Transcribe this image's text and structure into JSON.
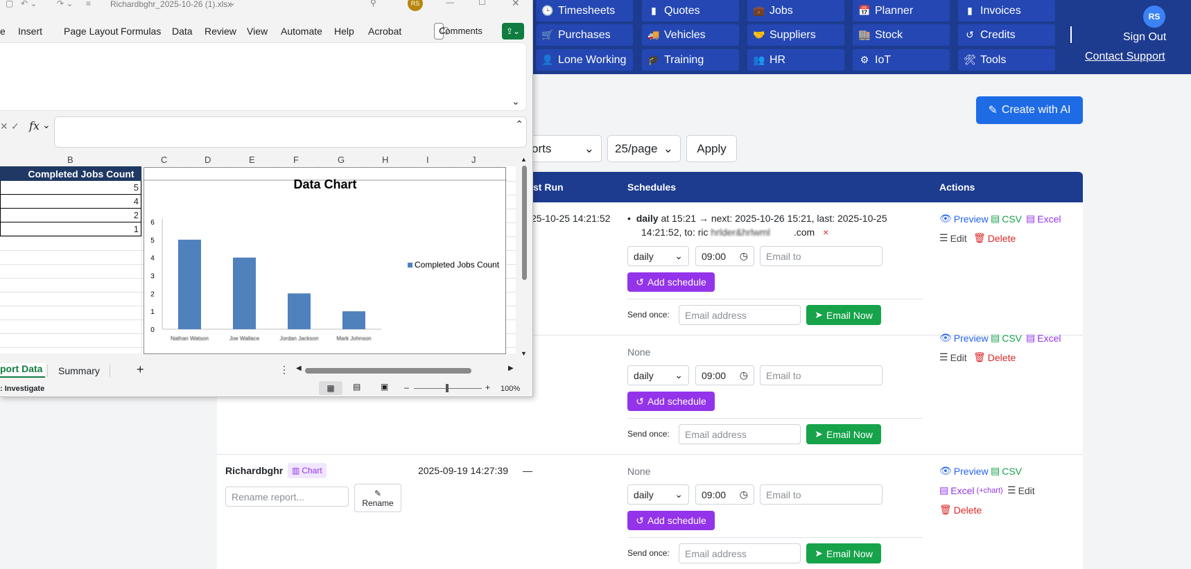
{
  "nav": {
    "items": [
      {
        "icon": "🕒",
        "label": "Timesheets"
      },
      {
        "icon": "▮",
        "label": "Quotes"
      },
      {
        "icon": "💼",
        "label": "Jobs"
      },
      {
        "icon": "📅",
        "label": "Planner"
      },
      {
        "icon": "▮",
        "label": "Invoices"
      },
      {
        "icon": "🛒",
        "label": "Purchases"
      },
      {
        "icon": "🚚",
        "label": "Vehicles"
      },
      {
        "icon": "🤝",
        "label": "Suppliers"
      },
      {
        "icon": "🏬",
        "label": "Stock"
      },
      {
        "icon": "↺",
        "label": "Credits"
      },
      {
        "icon": "👤",
        "label": "Lone Working"
      },
      {
        "icon": "🎓",
        "label": "Training"
      },
      {
        "icon": "👥",
        "label": "HR"
      },
      {
        "icon": "⚙",
        "label": "IoT"
      },
      {
        "icon": "🛠",
        "label": "Tools"
      }
    ],
    "avatar": "RS",
    "sign_out": "Sign Out",
    "contact_support": "Contact Support"
  },
  "toolbar": {
    "create_ai": "Create with AI",
    "filter_select": "orts",
    "page_size": "25/page",
    "apply": "Apply"
  },
  "table": {
    "headers": {
      "last_run": "st Run",
      "schedules": "Schedules",
      "actions": "Actions"
    },
    "rows": [
      {
        "last_run": "25-10-25 14:21:52",
        "schedule_freq": "daily",
        "schedule_detail": "at 15:21 → next: 2025-10-26 15:21, last: 2025-10-25",
        "schedule_detail2": "14:21:52, to: ric",
        "schedule_redacted": "hrlder&hrlwml",
        "schedule_tail": ".com",
        "remove": "×"
      },
      {
        "schedule_none": "None"
      },
      {
        "name": "Richardbghr",
        "chart_badge": "Chart",
        "created": "2025-09-19 14:27:39",
        "last_run": "—",
        "schedule_none": "None",
        "rename_placeholder": "Rename report...",
        "rename": "Rename"
      }
    ],
    "form": {
      "freq": "daily",
      "time": "09:00",
      "email_to": "Email to",
      "add_schedule": "Add schedule",
      "send_once": "Send once:",
      "email_address": "Email address",
      "email_now": "Email Now"
    },
    "actions": {
      "preview": "Preview",
      "csv": "CSV",
      "excel": "Excel",
      "excel_chart": "Excel",
      "excel_chart_suffix": "(+chart)",
      "edit": "Edit",
      "delete": "Delete"
    }
  },
  "excel": {
    "filename": "Richardbghr_2025-10-26 (1).xlsx",
    "user_initials": "RS",
    "menu": [
      "e",
      "Insert",
      "Page Layout",
      "Formulas",
      "Data",
      "Review",
      "View",
      "Automate",
      "Help",
      "Acrobat"
    ],
    "comments": "Comments",
    "fx": "fx",
    "columns": [
      "B",
      "C",
      "D",
      "E",
      "F",
      "G",
      "H",
      "I",
      "J"
    ],
    "header_cell": "Completed Jobs Count",
    "sheet_tabs": [
      "port Data",
      "Summary"
    ],
    "add_sheet": "+",
    "status_left": ": Investigate",
    "zoom": "100%"
  },
  "chart_data": {
    "type": "bar",
    "title": "Data Chart",
    "categories": [
      "Nathan Watson",
      "Joe Wallace",
      "Jordan Jackson",
      "Mark Johnson"
    ],
    "series": [
      {
        "name": "Completed Jobs Count",
        "values": [
          5,
          4,
          2,
          1
        ]
      }
    ],
    "ylim": [
      0,
      6
    ],
    "yticks": [
      0,
      1,
      2,
      3,
      4,
      5,
      6
    ],
    "legend": "right",
    "color": "#4f81bd"
  },
  "colors": {
    "nav_bg": "#1d3c8f",
    "nav_btn": "#2447b3",
    "primary": "#1e6be6",
    "purple": "#9333ea",
    "green": "#16a34a",
    "red": "#dc2626",
    "excel_header": "#1f3864"
  }
}
